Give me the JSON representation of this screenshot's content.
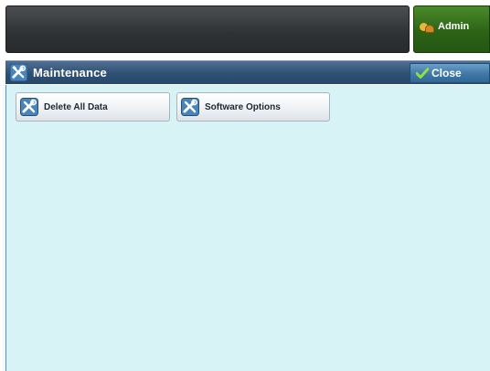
{
  "header": {
    "admin_label": "Admin",
    "admin_icon": "admin-user-icon"
  },
  "titlebar": {
    "title": "Maintenance",
    "title_icon": "tools-icon",
    "close_label": "Close",
    "close_icon": "check-icon"
  },
  "main": {
    "tiles": [
      {
        "label": "Delete All Data",
        "icon": "tools-icon"
      },
      {
        "label": "Software Options",
        "icon": "tools-icon"
      }
    ]
  },
  "colors": {
    "accent_blue": "#2f5073",
    "admin_green": "#2c6416",
    "panel_bg": "#d8f3f6"
  }
}
